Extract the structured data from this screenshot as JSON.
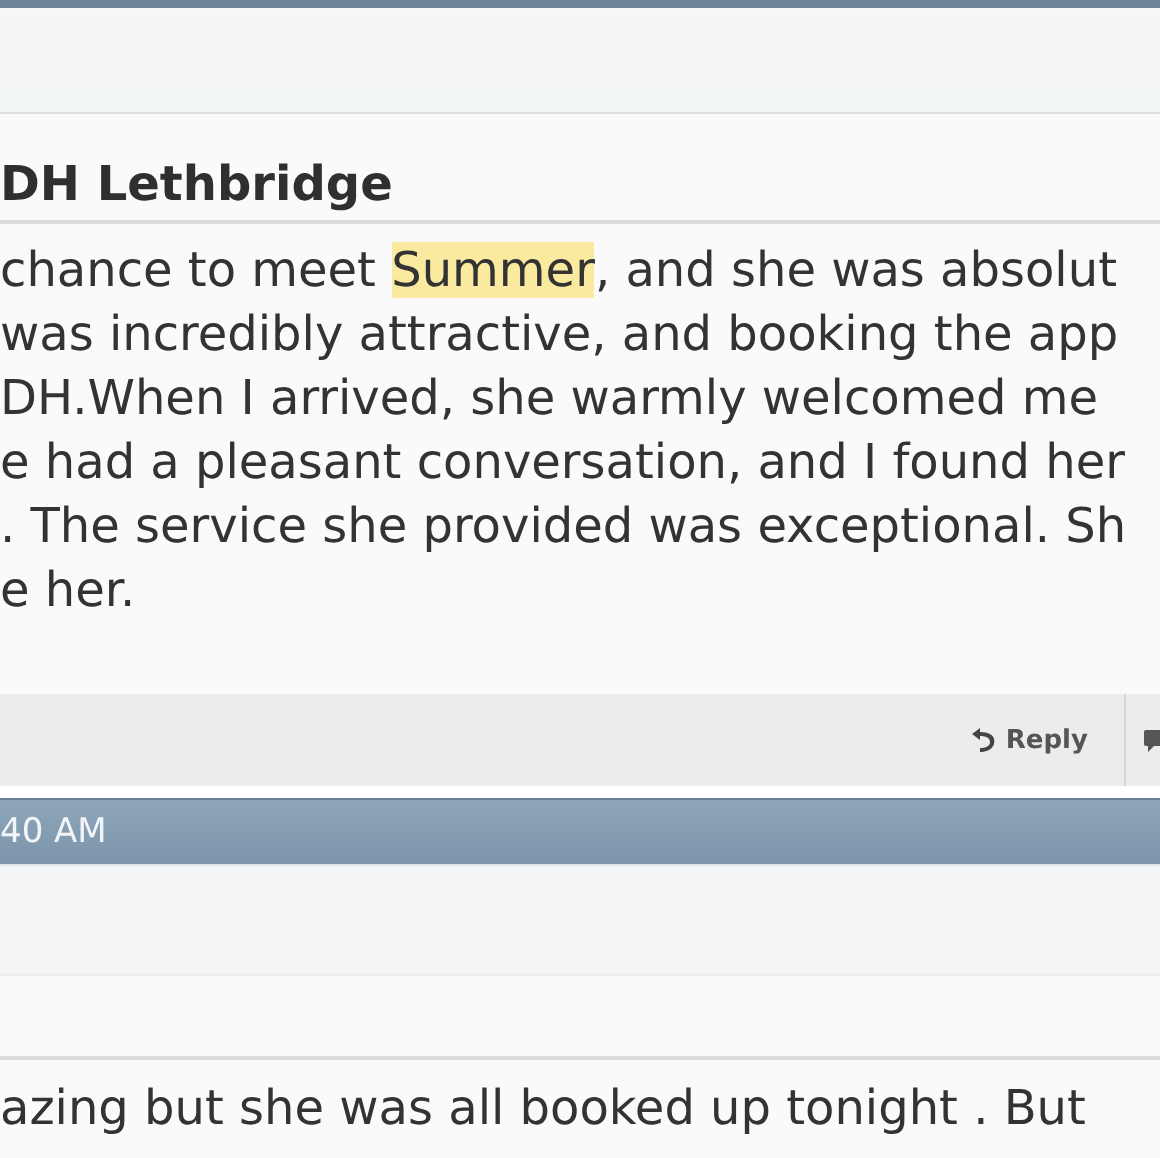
{
  "post": {
    "title": "DH Lethbridge",
    "lines": [
      {
        "before": "chance to meet ",
        "highlight": "Summer",
        "after": ", and she was absolut"
      },
      {
        "before": "was incredibly attractive, and booking the app"
      },
      {
        "before": "DH.When I arrived, she warmly welcomed me"
      },
      {
        "before": "e had a pleasant conversation, and I found her"
      },
      {
        "before": ". The service she provided was exceptional. Sh"
      },
      {
        "before": "e her."
      }
    ],
    "actions": [
      {
        "label": "Reply"
      }
    ]
  },
  "next_post": {
    "time": "40 AM",
    "lines": [
      "azing but she was all booked up tonight . But"
    ]
  }
}
